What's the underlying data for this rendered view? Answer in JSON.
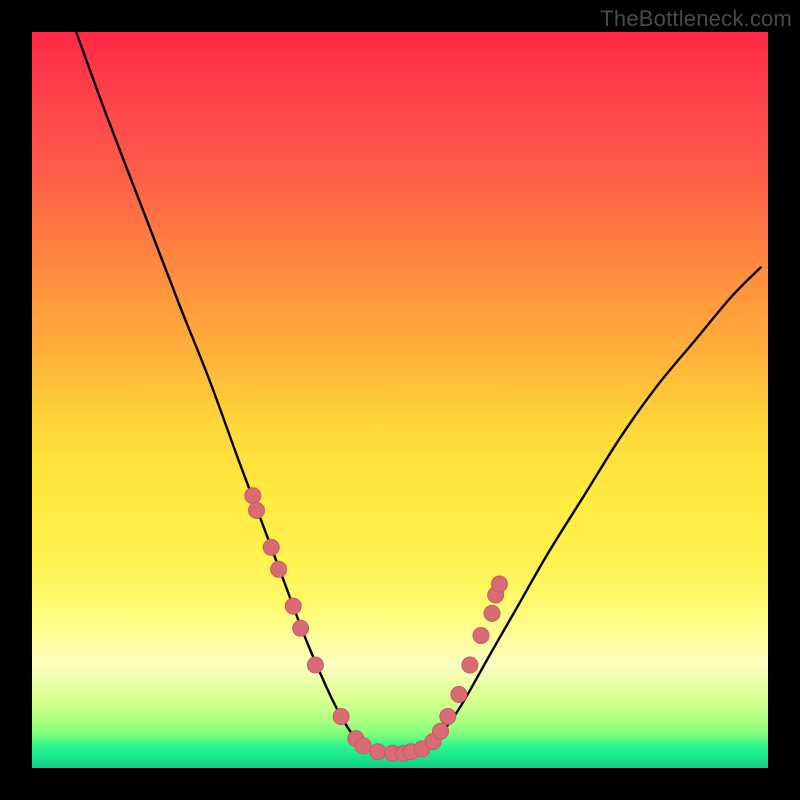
{
  "watermark": "TheBottleneck.com",
  "colors": {
    "frame": "#000000",
    "curve": "#000000",
    "marker_fill": "#d86b74",
    "marker_stroke": "#c85a64",
    "gradient_top": "#ff2a45",
    "gradient_mid": "#ffe83f",
    "gradient_bottom": "#12cf80"
  },
  "chart_data": {
    "type": "line",
    "title": "",
    "xlabel": "",
    "ylabel": "",
    "xlim": [
      0,
      100
    ],
    "ylim": [
      0,
      100
    ],
    "grid": false,
    "series": [
      {
        "name": "bottleneck-curve",
        "x": [
          6,
          10,
          15,
          20,
          24,
          28,
          31,
          34,
          37,
          40,
          42,
          44,
          46,
          48,
          49.5,
          51,
          53,
          55,
          58,
          62,
          66,
          70,
          75,
          80,
          85,
          90,
          95,
          99
        ],
        "y": [
          100,
          89,
          76,
          63,
          53,
          42,
          34,
          26,
          18,
          11,
          7,
          4,
          2.5,
          2,
          2,
          2,
          2.5,
          4,
          8,
          15,
          22,
          29,
          37,
          45,
          52,
          58,
          64,
          68
        ]
      }
    ],
    "markers": {
      "name": "sample-points",
      "x": [
        30,
        30.5,
        32.5,
        33.5,
        35.5,
        36.5,
        38.5,
        42,
        44,
        45,
        47,
        49,
        50.5,
        51.5,
        53,
        54.5,
        55.5,
        56.5,
        58,
        59.5,
        61,
        62.5,
        63,
        63.5
      ],
      "y": [
        37,
        35,
        30,
        27,
        22,
        19,
        14,
        7,
        4,
        3,
        2.2,
        2,
        2,
        2.2,
        2.6,
        3.6,
        5,
        7,
        10,
        14,
        18,
        21,
        23.5,
        25
      ]
    },
    "annotations": []
  }
}
